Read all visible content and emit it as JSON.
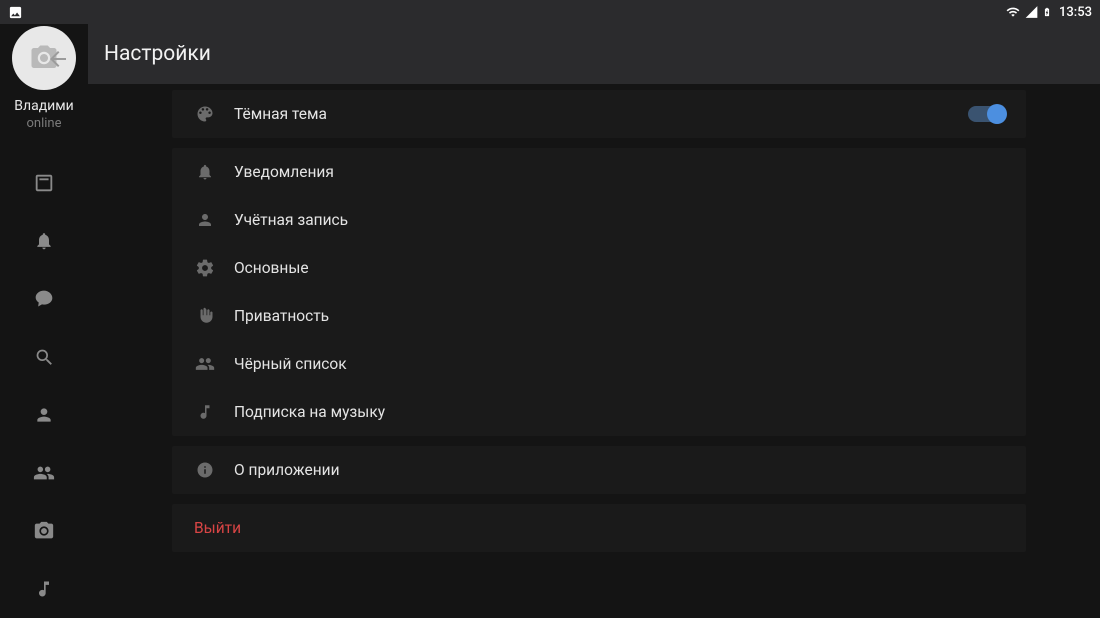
{
  "statusbar": {
    "time": "13:53"
  },
  "user": {
    "name": "Владими",
    "status": "online"
  },
  "header": {
    "title": "Настройки"
  },
  "settings": {
    "dark_theme": {
      "label": "Тёмная тема",
      "enabled": true
    },
    "items": [
      {
        "key": "notifications",
        "label": "Уведомления"
      },
      {
        "key": "account",
        "label": "Учётная запись"
      },
      {
        "key": "general",
        "label": "Основные"
      },
      {
        "key": "privacy",
        "label": "Приватность"
      },
      {
        "key": "blacklist",
        "label": "Чёрный список"
      },
      {
        "key": "music_sub",
        "label": "Подписка на музыку"
      }
    ],
    "about": {
      "label": "О приложении"
    },
    "logout": {
      "label": "Выйти"
    }
  }
}
